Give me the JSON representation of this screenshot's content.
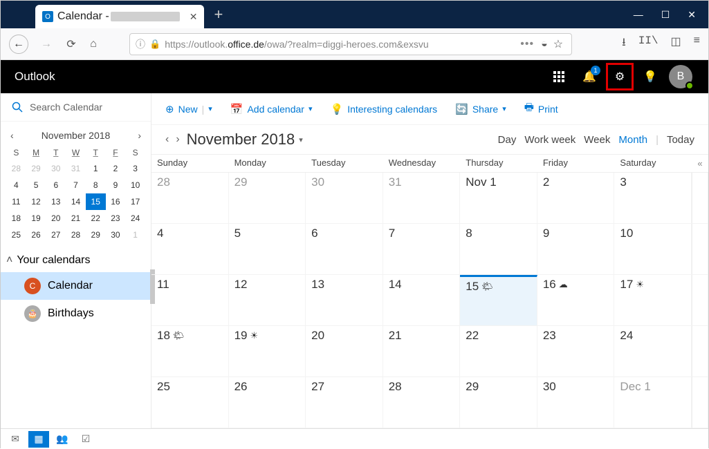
{
  "browser": {
    "tab_title_prefix": "Calendar - ",
    "url_pre": "https://outlook.",
    "url_bold": "office.de",
    "url_post": "/owa/?realm=diggi-heroes.com&exsvu"
  },
  "outlook": {
    "brand": "Outlook",
    "notifications": "1",
    "avatar_initial": "B"
  },
  "sidebar": {
    "search_placeholder": "Search Calendar",
    "mini_title": "November 2018",
    "day_headers": [
      "S",
      "M",
      "T",
      "W",
      "T",
      "F",
      "S"
    ],
    "prev_days": [
      "28",
      "29",
      "30",
      "31"
    ],
    "days": [
      "1",
      "2",
      "3",
      "4",
      "5",
      "6",
      "7",
      "8",
      "9",
      "10",
      "11",
      "12",
      "13",
      "14",
      "15",
      "16",
      "17",
      "18",
      "19",
      "20",
      "21",
      "22",
      "23",
      "24",
      "25",
      "26",
      "27",
      "28",
      "29",
      "30"
    ],
    "next_days": [
      "1"
    ],
    "selected_day": "15",
    "your_calendars_label": "Your calendars",
    "items": [
      {
        "label": "Calendar",
        "initial": "C",
        "color": "cc-orange",
        "active": true
      },
      {
        "label": "Birthdays",
        "initial": "",
        "color": "cc-gray",
        "active": false
      }
    ]
  },
  "toolbar": {
    "new_label": "New",
    "add_cal_label": "Add calendar",
    "interesting_label": "Interesting calendars",
    "share_label": "Share",
    "print_label": "Print"
  },
  "header": {
    "title": "November 2018",
    "views": {
      "day": "Day",
      "workweek": "Work week",
      "week": "Week",
      "month": "Month",
      "today": "Today"
    },
    "active_view": "Month"
  },
  "grid": {
    "day_headers": [
      "Sunday",
      "Monday",
      "Tuesday",
      "Wednesday",
      "Thursday",
      "Friday",
      "Saturday"
    ],
    "rows": [
      [
        {
          "l": "28"
        },
        {
          "l": "29"
        },
        {
          "l": "30"
        },
        {
          "l": "31"
        },
        {
          "l": "Nov 1",
          "cur": true
        },
        {
          "l": "2",
          "cur": true
        },
        {
          "l": "3",
          "cur": true
        }
      ],
      [
        {
          "l": "4",
          "cur": true
        },
        {
          "l": "5",
          "cur": true
        },
        {
          "l": "6",
          "cur": true
        },
        {
          "l": "7",
          "cur": true
        },
        {
          "l": "8",
          "cur": true
        },
        {
          "l": "9",
          "cur": true
        },
        {
          "l": "10",
          "cur": true
        }
      ],
      [
        {
          "l": "11",
          "cur": true
        },
        {
          "l": "12",
          "cur": true
        },
        {
          "l": "13",
          "cur": true
        },
        {
          "l": "14",
          "cur": true
        },
        {
          "l": "15",
          "cur": true,
          "today": true,
          "w": "🌤"
        },
        {
          "l": "16",
          "cur": true,
          "w": "☁"
        },
        {
          "l": "17",
          "cur": true,
          "w": "☀"
        }
      ],
      [
        {
          "l": "18",
          "cur": true,
          "w": "🌤"
        },
        {
          "l": "19",
          "cur": true,
          "w": "☀"
        },
        {
          "l": "20",
          "cur": true
        },
        {
          "l": "21",
          "cur": true
        },
        {
          "l": "22",
          "cur": true
        },
        {
          "l": "23",
          "cur": true
        },
        {
          "l": "24",
          "cur": true
        }
      ],
      [
        {
          "l": "25",
          "cur": true
        },
        {
          "l": "26",
          "cur": true
        },
        {
          "l": "27",
          "cur": true
        },
        {
          "l": "28",
          "cur": true
        },
        {
          "l": "29",
          "cur": true
        },
        {
          "l": "30",
          "cur": true
        },
        {
          "l": "Dec 1"
        }
      ]
    ]
  }
}
